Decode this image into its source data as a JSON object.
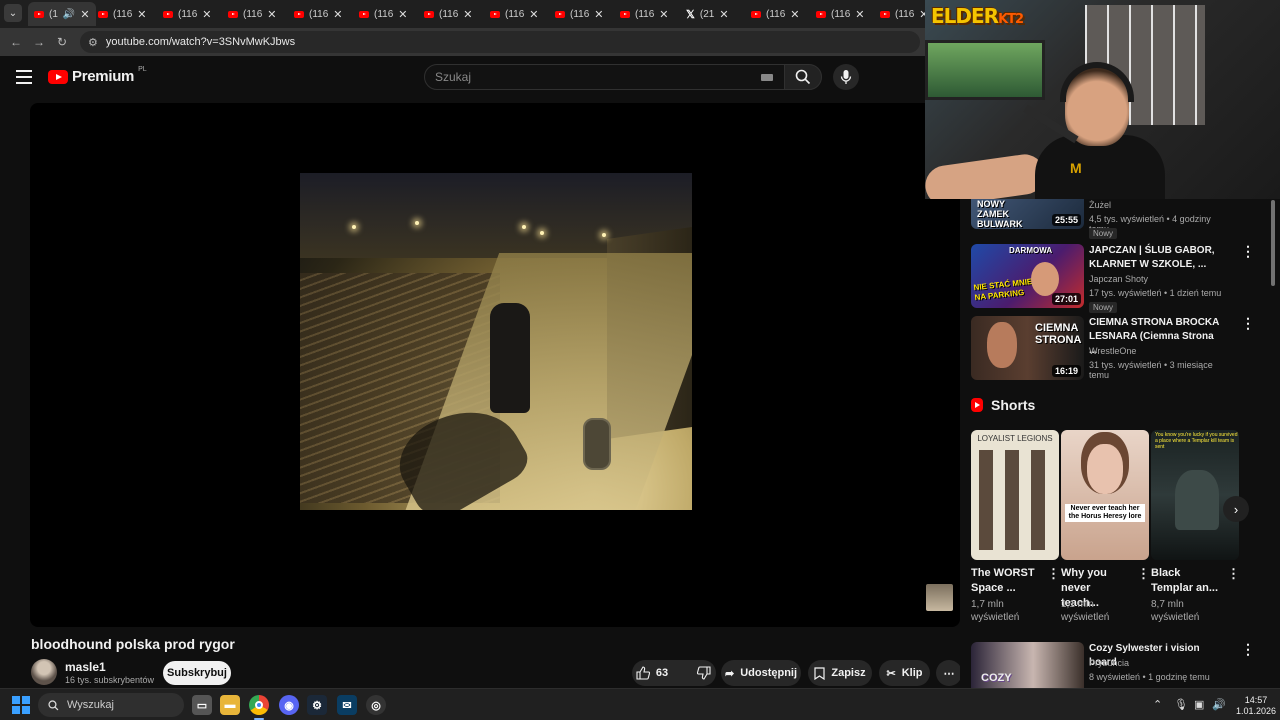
{
  "browser": {
    "tabs": [
      {
        "label": "(1",
        "active": true,
        "icon": "youtube-icon"
      },
      {
        "label": "(116",
        "icon": "youtube-icon"
      },
      {
        "label": "(116",
        "icon": "youtube-icon"
      },
      {
        "label": "(116",
        "icon": "youtube-icon"
      },
      {
        "label": "(116",
        "icon": "youtube-icon"
      },
      {
        "label": "(116",
        "icon": "youtube-icon"
      },
      {
        "label": "(116",
        "icon": "youtube-icon"
      },
      {
        "label": "(116",
        "icon": "youtube-icon"
      },
      {
        "label": "(116",
        "icon": "youtube-icon"
      },
      {
        "label": "(116",
        "icon": "youtube-icon"
      },
      {
        "label": "(21",
        "icon": "x-icon"
      },
      {
        "label": "(116",
        "icon": "youtube-icon"
      },
      {
        "label": "(116",
        "icon": "youtube-icon"
      },
      {
        "label": "(116",
        "icon": "youtube-icon"
      }
    ],
    "url": "youtube.com/watch?v=3SNvMwKJbws"
  },
  "yt": {
    "logo_text": "Premium",
    "logo_region": "PL",
    "search_placeholder": "Szukaj"
  },
  "video": {
    "title": "bloodhound polska prod rygor",
    "channel": "masle1",
    "subscribers": "16 tys. subskrybentów",
    "subscribe_label": "Subskrybuj",
    "likes": "63",
    "share_label": "Udostępnij",
    "save_label": "Zapisz",
    "clip_label": "Klip"
  },
  "sidebar": {
    "videos": [
      {
        "title": "",
        "channel": "Żużel",
        "meta": "4,5 tys. wyświetleń • 4 godziny temu",
        "badge": "Nowy",
        "duration": "25:55",
        "thumb_text": "NOWY ZAMEK BULWARK"
      },
      {
        "title": "JAPCZAN | ŚLUB GABOR, KLARNET W SZKOLE, ...",
        "channel": "Japczan Shoty",
        "meta": "17 tys. wyświetleń • 1 dzień temu",
        "badge": "Nowy",
        "duration": "27:01",
        "thumb_text": "NIE STAĆ MNIE NA PARKING",
        "thumb_top": "DARMOWA"
      },
      {
        "title": "CIEMNA STRONA BROCKA LESNARA (Ciemna Strona ...",
        "channel": "WrestleOne",
        "meta": "31 tys. wyświetleń • 3 miesiące temu",
        "duration": "16:19",
        "thumb_text": "CIEMNA STRONA"
      }
    ],
    "shorts_heading": "Shorts",
    "shorts": [
      {
        "title": "The WORST Space ...",
        "views": "1,7 mln wyświetleń",
        "thumb_text": "LOYALIST LEGIONS"
      },
      {
        "title": "Why you never teach...",
        "views": "1,1 mln wyświetleń",
        "thumb_text": "Never ever teach her the Horus Heresy lore"
      },
      {
        "title": "Black Templar an...",
        "views": "8,7 mln wyświetleń",
        "thumb_text": "You know you're lucky if you survived a place where a Templar kill team is sent"
      }
    ],
    "extra_video": {
      "title": "Cozy Sylwester i vision board",
      "channel": "Prybuncia",
      "meta": "8 wyświetleń • 1 godzinę temu",
      "thumb_text": "COZY"
    }
  },
  "webcam": {
    "logo_main": "ELDER",
    "logo_suffix": "KT2"
  },
  "taskbar": {
    "search_placeholder": "Wyszukaj",
    "time": "14:57",
    "date": "1.01.2026",
    "apps": [
      "file-explorer-icon",
      "folder-icon",
      "chrome-icon",
      "discord-icon",
      "steam-icon",
      "mail-icon",
      "steam-helper-icon"
    ]
  },
  "colors": {
    "accent": "#ff0000",
    "background": "#0f0f0f",
    "elder_logo": "#f5c400"
  }
}
